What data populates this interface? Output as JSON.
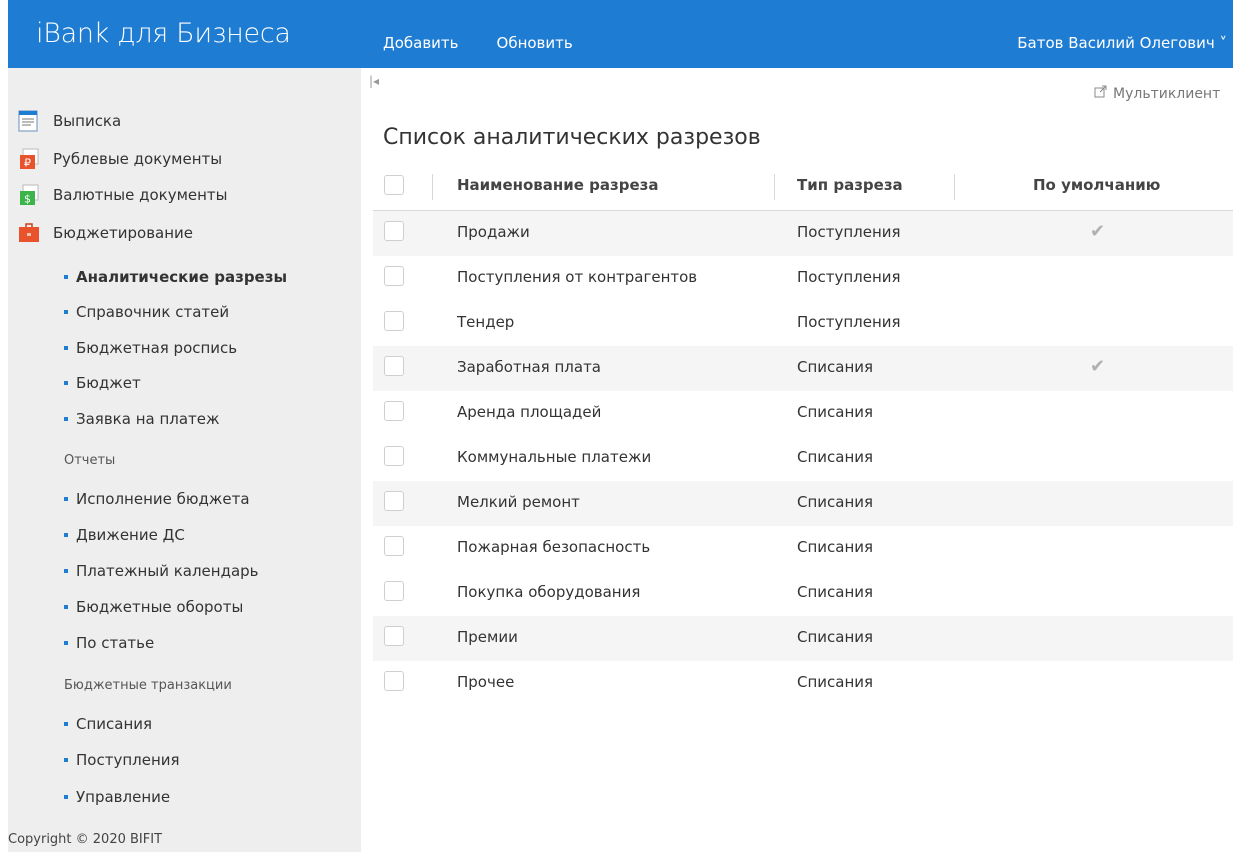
{
  "header": {
    "brand": "iBank для Бизнеса",
    "actions": [
      "Добавить",
      "Обновить"
    ],
    "user": "Батов Василий Олегович ˅"
  },
  "sidebar": {
    "main_items": [
      {
        "label": "Выписка",
        "icon": "statement-icon"
      },
      {
        "label": "Рублевые документы",
        "icon": "ruble-documents-icon"
      },
      {
        "label": "Валютные документы",
        "icon": "currency-documents-icon"
      },
      {
        "label": "Бюджетирование",
        "icon": "budget-briefcase-icon"
      }
    ],
    "budget_items": [
      "Аналитические разрезы",
      "Справочник статей",
      "Бюджетная роспись",
      "Бюджет",
      "Заявка на платеж"
    ],
    "reports_title": "Отчеты",
    "reports_items": [
      "Исполнение бюджета",
      "Движение ДС",
      "Платежный календарь",
      "Бюджетные обороты",
      "По статье"
    ],
    "transactions_title": "Бюджетные транзакции",
    "transactions_items": [
      "Списания",
      "Поступления",
      "Управление"
    ],
    "copyright": "Copyright © 2020 BIFIT"
  },
  "main": {
    "multiclient": "Мультиклиент",
    "title": "Список аналитических разрезов",
    "columns": [
      "Наименование разреза",
      "Тип разреза",
      "По умолчанию"
    ],
    "rows": [
      {
        "name": "Продажи",
        "type": "Поступления",
        "default": true
      },
      {
        "name": "Поступления от контрагентов",
        "type": "Поступления",
        "default": false
      },
      {
        "name": "Тендер",
        "type": "Поступления",
        "default": false
      },
      {
        "name": "Заработная плата",
        "type": "Списания",
        "default": true
      },
      {
        "name": "Аренда площадей",
        "type": "Списания",
        "default": false
      },
      {
        "name": "Коммунальные платежи",
        "type": "Списания",
        "default": false
      },
      {
        "name": "Мелкий ремонт",
        "type": "Списания",
        "default": false
      },
      {
        "name": "Пожарная безопасность",
        "type": "Списания",
        "default": false
      },
      {
        "name": "Покупка оборудования",
        "type": "Списания",
        "default": false
      },
      {
        "name": "Премии",
        "type": "Списания",
        "default": false
      },
      {
        "name": "Прочее",
        "type": "Списания",
        "default": false
      }
    ]
  },
  "colors": {
    "accent": "#1e7cd3",
    "sidebar_bg": "#eeeeee",
    "row_alt": "#f5f5f5"
  }
}
